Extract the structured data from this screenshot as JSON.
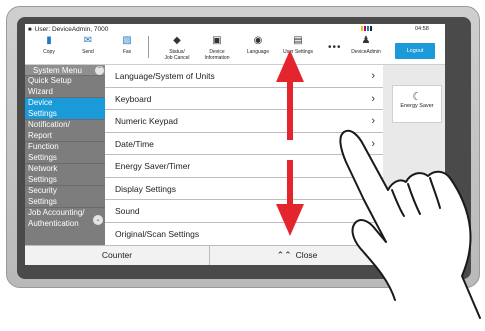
{
  "status": {
    "user": "User: DeviceAdmin, 7000",
    "time": "04:58",
    "indicator_colors": [
      "#f4c400",
      "#b4007a",
      "#1e78c2",
      "#222222"
    ]
  },
  "toolbar": {
    "copy": "Copy",
    "send": "Send",
    "fax": "Fax",
    "status_line1": "Status/",
    "status_line2": "Job Cancel",
    "device_line1": "Device",
    "device_line2": "Information",
    "language": "Language",
    "user_settings": "User Settings",
    "device_admin": "DeviceAdmin",
    "logout": "Logout"
  },
  "sidebar": {
    "title": "System Menu",
    "items": [
      {
        "line1": "Quick Setup",
        "line2": "Wizard"
      },
      {
        "line1": "Device",
        "line2": "Settings"
      },
      {
        "line1": "Notification/",
        "line2": "Report"
      },
      {
        "line1": "Function",
        "line2": "Settings"
      },
      {
        "line1": "Network",
        "line2": "Settings"
      },
      {
        "line1": "Security",
        "line2": "Settings"
      },
      {
        "line1": "Job Accounting/",
        "line2": "Authentication"
      }
    ],
    "active_index": 1
  },
  "settings_list": [
    "Language/System of Units",
    "Keyboard",
    "Numeric Keypad",
    "Date/Time",
    "Energy Saver/Timer",
    "Display Settings",
    "Sound",
    "Original/Scan Settings"
  ],
  "right_panel": {
    "energy_saver": "Energy Saver"
  },
  "bottom": {
    "counter": "Counter",
    "close": "Close"
  },
  "colors": {
    "accent": "#1a9ad8",
    "arrow": "#e3262e",
    "sidebar": "#7d7d7d",
    "yellow": "#f4a000"
  }
}
